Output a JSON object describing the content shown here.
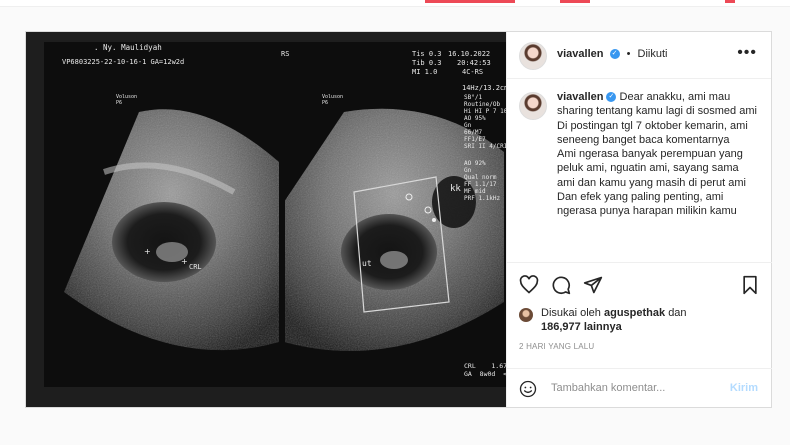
{
  "colors": {
    "accent": "#3897f0",
    "post_button": "#b3dbff",
    "muted": "#8e8e8e",
    "top_red": "#ed4956"
  },
  "ultrasound": {
    "patient": ". Ny. Maulidyah",
    "id": "VP6803225-22-10-16-1  GA=12w2d",
    "rs": "RS",
    "tis1": "Tis 0.3",
    "tib": "Tib 0.3",
    "mi": "MI 1.0",
    "date": "16.10.2022",
    "time": "20:42:53",
    "probe": "4C-RS",
    "freq": "14Hz/13.2cm",
    "labels": {
      "crl": "CRL",
      "kk": "kk",
      "ut": "ut"
    },
    "crl_box": "CRL    1.67cm\nGA  8w0d  <1%",
    "right_info": "SB°/1\nRoutine/Ob\nHi HI P 7 10 - 1.3/0\nAO 95%\nGn\n66/M7\nFF1/E7\nSRI II 4/CRI 2",
    "right_info2": "AO 92%\nGn\nQual norm\nFF 1.1/17\nMF mid\nPRF 1.1kHz",
    "voluson": "Voluson\nP6"
  },
  "post": {
    "username": "viavallen",
    "follow_status": "Diikuti",
    "more_label": "•••",
    "caption_lines": [
      "Dear anakku, ami mau sharing tentang kamu lagi di sosmed ami",
      "Di postingan tgl 7 oktober kemarin, ami seneeng banget baca komentarnya",
      "Ami ngerasa banyak perempuan yang peluk ami, nguatin ami, sayang sama ami dan kamu yang masih di perut ami",
      "Dan efek yang paling penting, ami ngerasa punya harapan milikin kamu"
    ],
    "likes_prefix": "Disukai oleh",
    "likes_user": "aguspethak",
    "likes_and": "dan",
    "likes_count": "186,977 lainnya",
    "timestamp": "2 HARI YANG LALU",
    "comment_placeholder": "Tambahkan komentar...",
    "post_label": "Kirim"
  }
}
